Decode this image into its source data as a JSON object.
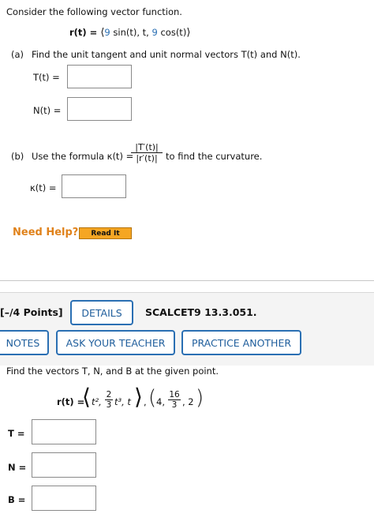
{
  "q1": {
    "intro": "Consider the following vector function.",
    "rfunc_left": "r(t) = ",
    "rfunc_num": "9",
    "rfunc_mid": " sin(t), t, ",
    "rfunc_num2": "9",
    "rfunc_end": " cos(t)",
    "part_a_label": "(a)",
    "part_a_text": "Find the unit tangent and unit normal vectors T(t) and N(t).",
    "T_label": "T(t) =",
    "N_label": "N(t) =",
    "part_b_label": "(b)",
    "part_b_text_pre": "Use the formula κ(t) =",
    "part_b_num": "|T′(t)|",
    "part_b_den": "|r′(t)|",
    "part_b_text_post": "to find the curvature.",
    "kappa_label": "κ(t) =",
    "need_help": "Need Help?",
    "read_it": "Read It"
  },
  "q2": {
    "points": "[–/4 Points]",
    "details": "DETAILS",
    "code": "SCALCET9 13.3.051.",
    "notes": "NOTES",
    "ask_teacher": "ASK YOUR TEACHER",
    "practice": "PRACTICE ANOTHER",
    "prompt": "Find the vectors T, N, and B at the given point.",
    "r_label": "r(t) =",
    "comp1": "t²,",
    "frac_num": "2",
    "frac_den": "3",
    "comp2": "t³, t",
    "pt_a": "4,",
    "pt_num": "16",
    "pt_den": "3",
    "pt_c": ", 2",
    "T_label": "T =",
    "N_label": "N =",
    "B_label": "B ="
  },
  "colors": {
    "accent": "#2a6fb3",
    "read_it_bg": "#f5a623",
    "need_help": "#e0821b"
  }
}
